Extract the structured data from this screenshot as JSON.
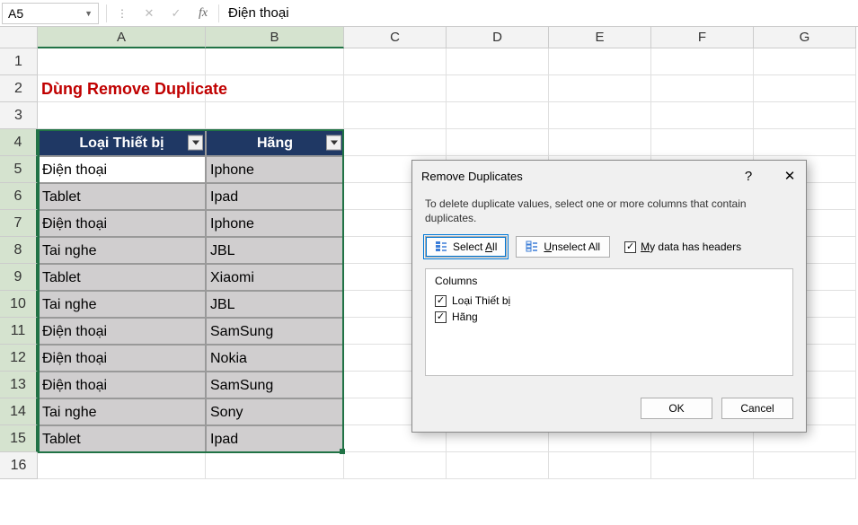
{
  "name_box": "A5",
  "formula_value": "Điện thoại",
  "columns": [
    "A",
    "B",
    "C",
    "D",
    "E",
    "F",
    "G"
  ],
  "rows": [
    1,
    2,
    3,
    4,
    5,
    6,
    7,
    8,
    9,
    10,
    11,
    12,
    13,
    14,
    15,
    16
  ],
  "title_text": "Dùng Remove Duplicate",
  "table": {
    "headers": [
      "Loại Thiết bị",
      "Hãng"
    ],
    "rows": [
      {
        "a": "Điện thoại",
        "b": "Iphone"
      },
      {
        "a": "Tablet",
        "b": "Ipad"
      },
      {
        "a": "Điện thoại",
        "b": "Iphone"
      },
      {
        "a": "Tai nghe",
        "b": "JBL"
      },
      {
        "a": "Tablet",
        "b": "Xiaomi"
      },
      {
        "a": "Tai nghe",
        "b": "JBL"
      },
      {
        "a": "Điện thoại",
        "b": "SamSung"
      },
      {
        "a": "Điện thoại",
        "b": "Nokia"
      },
      {
        "a": "Điện thoại",
        "b": "SamSung"
      },
      {
        "a": "Tai nghe",
        "b": "Sony"
      },
      {
        "a": "Tablet",
        "b": "Ipad"
      }
    ]
  },
  "dialog": {
    "title": "Remove Duplicates",
    "help": "?",
    "close": "✕",
    "instruction": "To delete duplicate values, select one or more columns that contain duplicates.",
    "select_all_prefix": "Select ",
    "select_all_u": "A",
    "select_all_suffix": "ll",
    "unselect_all_u": "U",
    "unselect_all_suffix": "nselect All",
    "my_data_u": "M",
    "my_data_suffix": "y data has headers",
    "columns_label": "Columns",
    "col_options": [
      "Loại Thiết bị",
      "Hãng"
    ],
    "ok": "OK",
    "cancel": "Cancel"
  }
}
